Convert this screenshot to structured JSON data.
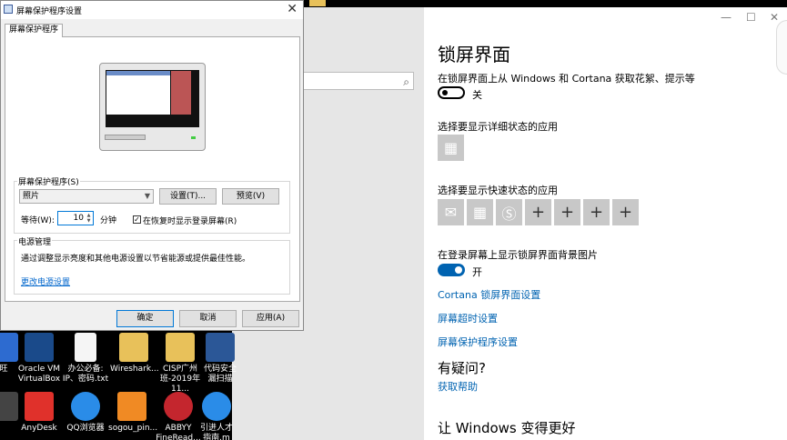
{
  "dialog": {
    "title": "屏幕保护程序设置",
    "tab": "屏幕保护程序",
    "saver_group_label": "屏幕保护程序(S)",
    "saver_selected": "照片",
    "settings_button": "设置(T)...",
    "preview_button": "预览(V)",
    "wait_label": "等待(W):",
    "wait_value": "10",
    "minutes_label": "分钟",
    "resume_checked": true,
    "resume_label": "在恢复时显示登录屏幕(R)",
    "power_group_label": "电源管理",
    "power_text": "通过调整显示亮度和其他电源设置以节省能源或提供最佳性能。",
    "power_link": "更改电源设置",
    "ok_button": "确定",
    "cancel_button": "取消",
    "apply_button": "应用(A)"
  },
  "settings": {
    "title": "锁屏界面",
    "fun_facts_label": "在锁屏界面上从 Windows 和 Cortana 获取花絮、提示等",
    "fun_facts_toggle": "关",
    "detailed_status_label": "选择要显示详细状态的应用",
    "quick_status_label": "选择要显示快速状态的应用",
    "show_bg_label": "在登录屏幕上显示锁屏界面背景图片",
    "show_bg_toggle": "开",
    "links": [
      "Cortana 锁屏界面设置",
      "屏幕超时设置",
      "屏幕保护程序设置"
    ],
    "questions_heading": "有疑问?",
    "help_link": "获取帮助",
    "improve_heading": "让 Windows 变得更好"
  },
  "desktop": {
    "icons_row1": [
      {
        "label": "旺",
        "color": "#2d6bd0"
      },
      {
        "label": "Oracle VM VirtualBox",
        "color": "#1a4a8a"
      },
      {
        "label": "办公必备: IP、密码.txt",
        "color": "#ffffff"
      },
      {
        "label": "Wireshark...",
        "color": "#e8c15a"
      },
      {
        "label": "CISP广州班-2019年11...",
        "color": "#e8c15a"
      },
      {
        "label": "代码安全漏扫描",
        "color": "#2b5797"
      }
    ],
    "icons_row2": [
      {
        "label": "AnyDesk",
        "color": "#e0312b"
      },
      {
        "label": "QQ浏览器",
        "color": "#2a8ce8"
      },
      {
        "label": "sogou_pin...",
        "color": "#f08a24"
      },
      {
        "label": "ABBYY FineRead...",
        "color": "#c4262e"
      },
      {
        "label": "引进人才指南.m",
        "color": "#2a8ce8"
      }
    ]
  }
}
